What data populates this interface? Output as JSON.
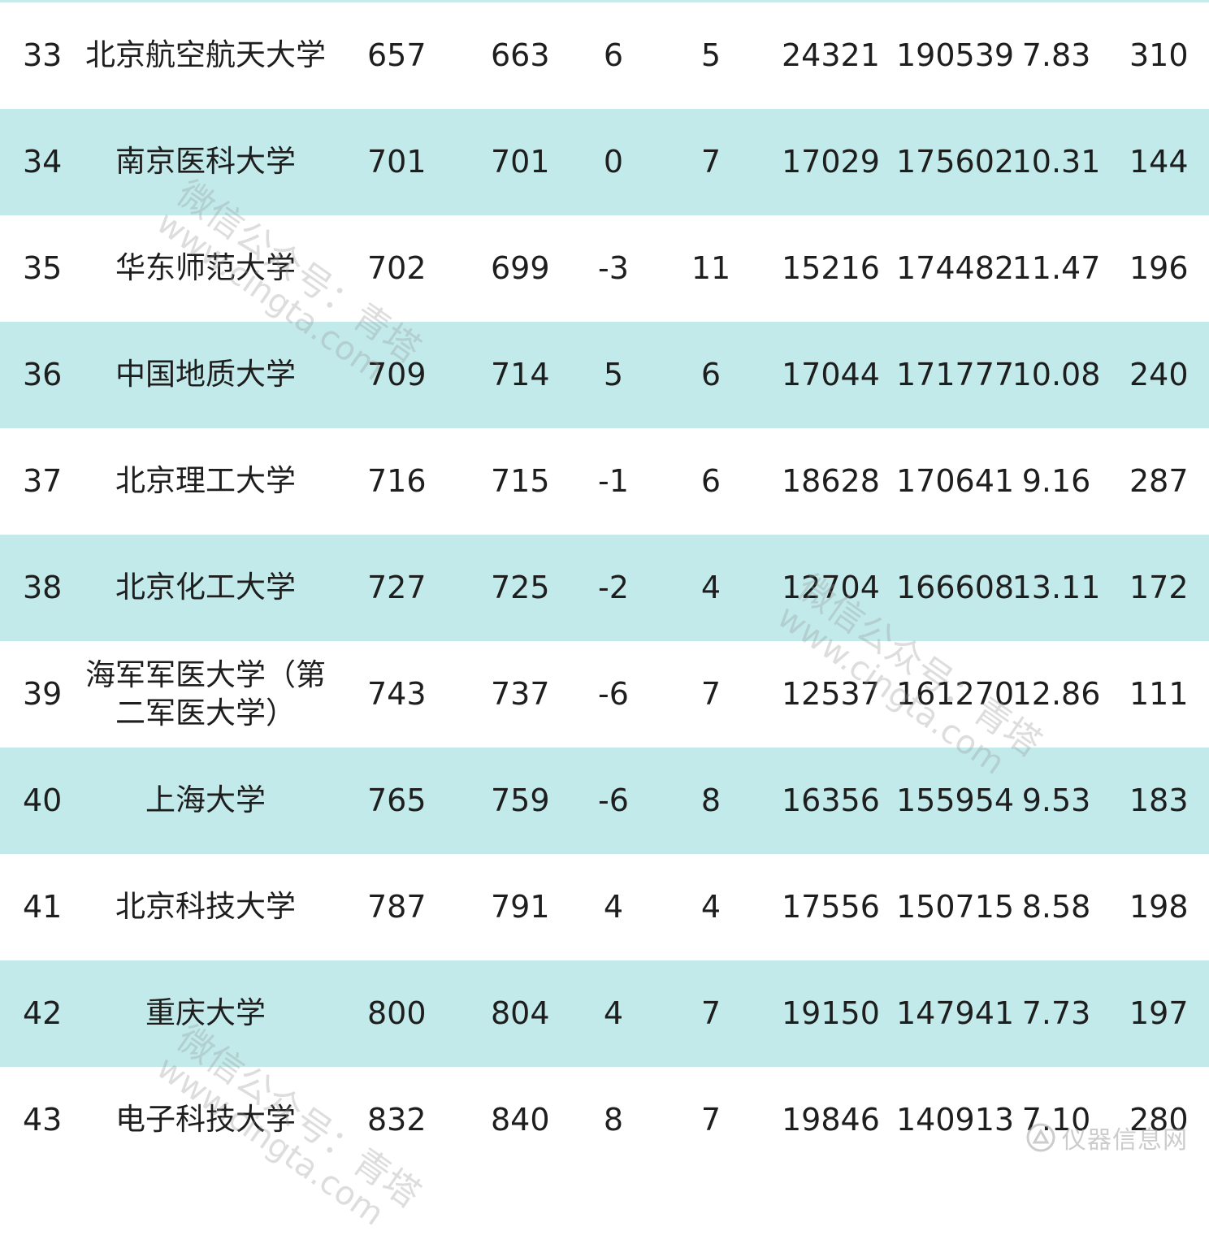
{
  "rows": [
    {
      "rank": "33",
      "name": "北京航空航天大学",
      "v1": "657",
      "v2": "663",
      "delta": "6",
      "count": "5",
      "n1": "24321",
      "n2": "190539",
      "ratio": "7.83",
      "last": "310"
    },
    {
      "rank": "34",
      "name": "南京医科大学",
      "v1": "701",
      "v2": "701",
      "delta": "0",
      "count": "7",
      "n1": "17029",
      "n2": "175602",
      "ratio": "10.31",
      "last": "144"
    },
    {
      "rank": "35",
      "name": "华东师范大学",
      "v1": "702",
      "v2": "699",
      "delta": "-3",
      "count": "11",
      "n1": "15216",
      "n2": "174482",
      "ratio": "11.47",
      "last": "196"
    },
    {
      "rank": "36",
      "name": "中国地质大学",
      "v1": "709",
      "v2": "714",
      "delta": "5",
      "count": "6",
      "n1": "17044",
      "n2": "171777",
      "ratio": "10.08",
      "last": "240"
    },
    {
      "rank": "37",
      "name": "北京理工大学",
      "v1": "716",
      "v2": "715",
      "delta": "-1",
      "count": "6",
      "n1": "18628",
      "n2": "170641",
      "ratio": "9.16",
      "last": "287"
    },
    {
      "rank": "38",
      "name": "北京化工大学",
      "v1": "727",
      "v2": "725",
      "delta": "-2",
      "count": "4",
      "n1": "12704",
      "n2": "166608",
      "ratio": "13.11",
      "last": "172"
    },
    {
      "rank": "39",
      "name": "海军军医大学（第二军医大学）",
      "v1": "743",
      "v2": "737",
      "delta": "-6",
      "count": "7",
      "n1": "12537",
      "n2": "161270",
      "ratio": "12.86",
      "last": "111"
    },
    {
      "rank": "40",
      "name": "上海大学",
      "v1": "765",
      "v2": "759",
      "delta": "-6",
      "count": "8",
      "n1": "16356",
      "n2": "155954",
      "ratio": "9.53",
      "last": "183"
    },
    {
      "rank": "41",
      "name": "北京科技大学",
      "v1": "787",
      "v2": "791",
      "delta": "4",
      "count": "4",
      "n1": "17556",
      "n2": "150715",
      "ratio": "8.58",
      "last": "198"
    },
    {
      "rank": "42",
      "name": "重庆大学",
      "v1": "800",
      "v2": "804",
      "delta": "4",
      "count": "7",
      "n1": "19150",
      "n2": "147941",
      "ratio": "7.73",
      "last": "197"
    },
    {
      "rank": "43",
      "name": "电子科技大学",
      "v1": "832",
      "v2": "840",
      "delta": "8",
      "count": "7",
      "n1": "19846",
      "n2": "140913",
      "ratio": "7.10",
      "last": "280"
    }
  ],
  "watermark": {
    "line1": "微信公众号：青塔",
    "line2": "www.cingta.com"
  },
  "corner_logo": {
    "text": "仪器信息网"
  },
  "colors": {
    "stripe": "#c2eaea",
    "text": "#1e1e1e",
    "background": "#ffffff"
  }
}
